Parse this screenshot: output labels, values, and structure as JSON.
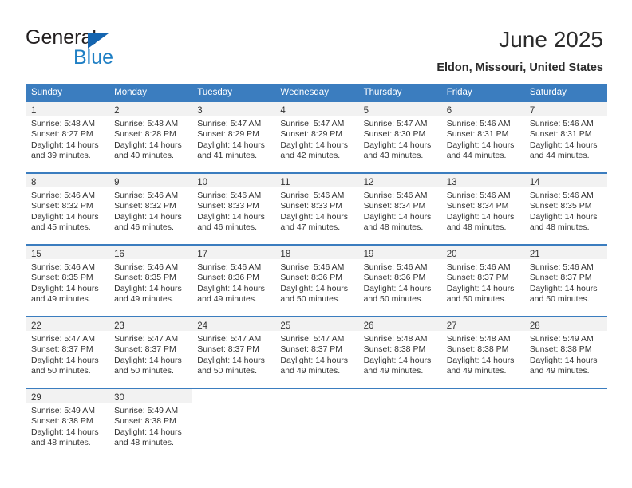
{
  "brand": {
    "name_part1": "General",
    "name_part2": "Blue",
    "triangle_color": "#1565b0",
    "blue_color": "#1f7fc4"
  },
  "header": {
    "title": "June 2025",
    "location": "Eldon, Missouri, United States"
  },
  "theme": {
    "header_bg": "#3b7dbf",
    "header_text": "#ffffff",
    "daynum_band_bg": "#f2f2f2",
    "cell_bg": "#ffffff",
    "text": "#333333"
  },
  "calendar": {
    "weekday_headers": [
      "Sunday",
      "Monday",
      "Tuesday",
      "Wednesday",
      "Thursday",
      "Friday",
      "Saturday"
    ],
    "weeks": [
      [
        {
          "day": "1",
          "sunrise": "Sunrise: 5:48 AM",
          "sunset": "Sunset: 8:27 PM",
          "daylight": "Daylight: 14 hours and 39 minutes."
        },
        {
          "day": "2",
          "sunrise": "Sunrise: 5:48 AM",
          "sunset": "Sunset: 8:28 PM",
          "daylight": "Daylight: 14 hours and 40 minutes."
        },
        {
          "day": "3",
          "sunrise": "Sunrise: 5:47 AM",
          "sunset": "Sunset: 8:29 PM",
          "daylight": "Daylight: 14 hours and 41 minutes."
        },
        {
          "day": "4",
          "sunrise": "Sunrise: 5:47 AM",
          "sunset": "Sunset: 8:29 PM",
          "daylight": "Daylight: 14 hours and 42 minutes."
        },
        {
          "day": "5",
          "sunrise": "Sunrise: 5:47 AM",
          "sunset": "Sunset: 8:30 PM",
          "daylight": "Daylight: 14 hours and 43 minutes."
        },
        {
          "day": "6",
          "sunrise": "Sunrise: 5:46 AM",
          "sunset": "Sunset: 8:31 PM",
          "daylight": "Daylight: 14 hours and 44 minutes."
        },
        {
          "day": "7",
          "sunrise": "Sunrise: 5:46 AM",
          "sunset": "Sunset: 8:31 PM",
          "daylight": "Daylight: 14 hours and 44 minutes."
        }
      ],
      [
        {
          "day": "8",
          "sunrise": "Sunrise: 5:46 AM",
          "sunset": "Sunset: 8:32 PM",
          "daylight": "Daylight: 14 hours and 45 minutes."
        },
        {
          "day": "9",
          "sunrise": "Sunrise: 5:46 AM",
          "sunset": "Sunset: 8:32 PM",
          "daylight": "Daylight: 14 hours and 46 minutes."
        },
        {
          "day": "10",
          "sunrise": "Sunrise: 5:46 AM",
          "sunset": "Sunset: 8:33 PM",
          "daylight": "Daylight: 14 hours and 46 minutes."
        },
        {
          "day": "11",
          "sunrise": "Sunrise: 5:46 AM",
          "sunset": "Sunset: 8:33 PM",
          "daylight": "Daylight: 14 hours and 47 minutes."
        },
        {
          "day": "12",
          "sunrise": "Sunrise: 5:46 AM",
          "sunset": "Sunset: 8:34 PM",
          "daylight": "Daylight: 14 hours and 48 minutes."
        },
        {
          "day": "13",
          "sunrise": "Sunrise: 5:46 AM",
          "sunset": "Sunset: 8:34 PM",
          "daylight": "Daylight: 14 hours and 48 minutes."
        },
        {
          "day": "14",
          "sunrise": "Sunrise: 5:46 AM",
          "sunset": "Sunset: 8:35 PM",
          "daylight": "Daylight: 14 hours and 48 minutes."
        }
      ],
      [
        {
          "day": "15",
          "sunrise": "Sunrise: 5:46 AM",
          "sunset": "Sunset: 8:35 PM",
          "daylight": "Daylight: 14 hours and 49 minutes."
        },
        {
          "day": "16",
          "sunrise": "Sunrise: 5:46 AM",
          "sunset": "Sunset: 8:35 PM",
          "daylight": "Daylight: 14 hours and 49 minutes."
        },
        {
          "day": "17",
          "sunrise": "Sunrise: 5:46 AM",
          "sunset": "Sunset: 8:36 PM",
          "daylight": "Daylight: 14 hours and 49 minutes."
        },
        {
          "day": "18",
          "sunrise": "Sunrise: 5:46 AM",
          "sunset": "Sunset: 8:36 PM",
          "daylight": "Daylight: 14 hours and 50 minutes."
        },
        {
          "day": "19",
          "sunrise": "Sunrise: 5:46 AM",
          "sunset": "Sunset: 8:36 PM",
          "daylight": "Daylight: 14 hours and 50 minutes."
        },
        {
          "day": "20",
          "sunrise": "Sunrise: 5:46 AM",
          "sunset": "Sunset: 8:37 PM",
          "daylight": "Daylight: 14 hours and 50 minutes."
        },
        {
          "day": "21",
          "sunrise": "Sunrise: 5:46 AM",
          "sunset": "Sunset: 8:37 PM",
          "daylight": "Daylight: 14 hours and 50 minutes."
        }
      ],
      [
        {
          "day": "22",
          "sunrise": "Sunrise: 5:47 AM",
          "sunset": "Sunset: 8:37 PM",
          "daylight": "Daylight: 14 hours and 50 minutes."
        },
        {
          "day": "23",
          "sunrise": "Sunrise: 5:47 AM",
          "sunset": "Sunset: 8:37 PM",
          "daylight": "Daylight: 14 hours and 50 minutes."
        },
        {
          "day": "24",
          "sunrise": "Sunrise: 5:47 AM",
          "sunset": "Sunset: 8:37 PM",
          "daylight": "Daylight: 14 hours and 50 minutes."
        },
        {
          "day": "25",
          "sunrise": "Sunrise: 5:47 AM",
          "sunset": "Sunset: 8:37 PM",
          "daylight": "Daylight: 14 hours and 49 minutes."
        },
        {
          "day": "26",
          "sunrise": "Sunrise: 5:48 AM",
          "sunset": "Sunset: 8:38 PM",
          "daylight": "Daylight: 14 hours and 49 minutes."
        },
        {
          "day": "27",
          "sunrise": "Sunrise: 5:48 AM",
          "sunset": "Sunset: 8:38 PM",
          "daylight": "Daylight: 14 hours and 49 minutes."
        },
        {
          "day": "28",
          "sunrise": "Sunrise: 5:49 AM",
          "sunset": "Sunset: 8:38 PM",
          "daylight": "Daylight: 14 hours and 49 minutes."
        }
      ],
      [
        {
          "day": "29",
          "sunrise": "Sunrise: 5:49 AM",
          "sunset": "Sunset: 8:38 PM",
          "daylight": "Daylight: 14 hours and 48 minutes."
        },
        {
          "day": "30",
          "sunrise": "Sunrise: 5:49 AM",
          "sunset": "Sunset: 8:38 PM",
          "daylight": "Daylight: 14 hours and 48 minutes."
        },
        null,
        null,
        null,
        null,
        null
      ]
    ]
  }
}
